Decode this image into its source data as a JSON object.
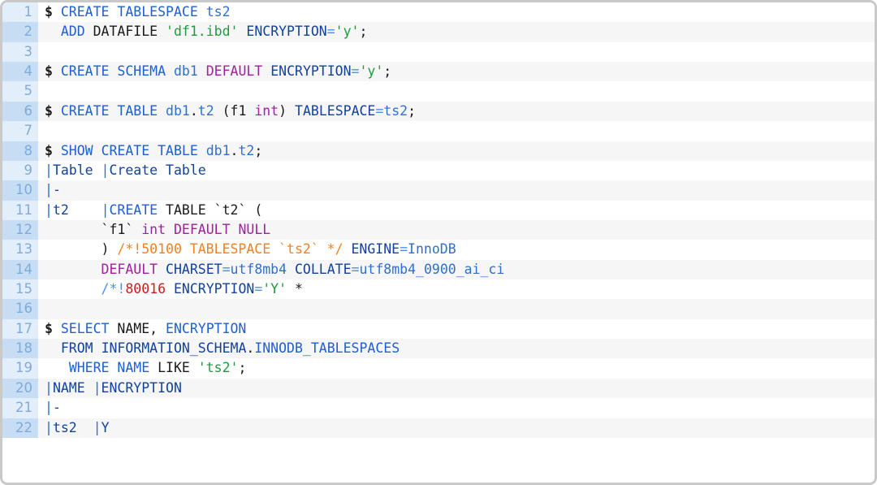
{
  "editor": {
    "name": "sql-code-block",
    "language": "sql",
    "total_lines": 22,
    "colors": {
      "keyword_bright": "#1f5fd0",
      "keyword_navy": "#12429c",
      "identifier": "#2f6fd0",
      "string": "#1f9b3f",
      "purple": "#a0229a",
      "orange": "#f58020",
      "number_red": "#d11b1b",
      "operator": "#4d8fe8",
      "plain": "#1a1a1a",
      "gutter_text": "#7faada",
      "gutter_odd_bg": "#e3eefb",
      "gutter_even_bg": "#c6ddf4",
      "content_odd_bg": "#ffffff",
      "content_even_bg": "#f6f6f6",
      "border": "#c9c9c9"
    }
  },
  "lines": [
    {
      "n": "1",
      "tokens": [
        {
          "t": "$ ",
          "c": "prompt"
        },
        {
          "t": "CREATE",
          "c": "kw"
        },
        {
          "t": " ",
          "c": "plain"
        },
        {
          "t": "TABLESPACE",
          "c": "kw"
        },
        {
          "t": " ",
          "c": "plain"
        },
        {
          "t": "ts2",
          "c": "ident"
        }
      ]
    },
    {
      "n": "2",
      "tokens": [
        {
          "t": "  ",
          "c": "plain"
        },
        {
          "t": "ADD",
          "c": "kw"
        },
        {
          "t": " ",
          "c": "plain"
        },
        {
          "t": "DATAFILE",
          "c": "plain"
        },
        {
          "t": " ",
          "c": "plain"
        },
        {
          "t": "'df1.ibd'",
          "c": "str"
        },
        {
          "t": " ",
          "c": "plain"
        },
        {
          "t": "ENCRYPTION",
          "c": "kw2"
        },
        {
          "t": "=",
          "c": "op"
        },
        {
          "t": "'y'",
          "c": "str"
        },
        {
          "t": ";",
          "c": "plain"
        }
      ]
    },
    {
      "n": "3",
      "tokens": []
    },
    {
      "n": "4",
      "tokens": [
        {
          "t": "$ ",
          "c": "prompt"
        },
        {
          "t": "CREATE",
          "c": "kw"
        },
        {
          "t": " ",
          "c": "plain"
        },
        {
          "t": "SCHEMA",
          "c": "kw"
        },
        {
          "t": " ",
          "c": "plain"
        },
        {
          "t": "db1",
          "c": "ident"
        },
        {
          "t": " ",
          "c": "plain"
        },
        {
          "t": "DEFAULT",
          "c": "purple"
        },
        {
          "t": " ",
          "c": "plain"
        },
        {
          "t": "ENCRYPTION",
          "c": "kw2"
        },
        {
          "t": "=",
          "c": "op"
        },
        {
          "t": "'y'",
          "c": "str"
        },
        {
          "t": ";",
          "c": "plain"
        }
      ]
    },
    {
      "n": "5",
      "tokens": []
    },
    {
      "n": "6",
      "tokens": [
        {
          "t": "$ ",
          "c": "prompt"
        },
        {
          "t": "CREATE",
          "c": "kw"
        },
        {
          "t": " ",
          "c": "plain"
        },
        {
          "t": "TABLE",
          "c": "kw"
        },
        {
          "t": " ",
          "c": "plain"
        },
        {
          "t": "db1",
          "c": "ident"
        },
        {
          "t": ".",
          "c": "plain"
        },
        {
          "t": "t2",
          "c": "ident"
        },
        {
          "t": " (",
          "c": "plain"
        },
        {
          "t": "f1",
          "c": "plain"
        },
        {
          "t": " ",
          "c": "plain"
        },
        {
          "t": "int",
          "c": "purple"
        },
        {
          "t": ") ",
          "c": "plain"
        },
        {
          "t": "TABLESPACE",
          "c": "kw2"
        },
        {
          "t": "=",
          "c": "op"
        },
        {
          "t": "ts2",
          "c": "ident"
        },
        {
          "t": ";",
          "c": "plain"
        }
      ]
    },
    {
      "n": "7",
      "tokens": []
    },
    {
      "n": "8",
      "tokens": [
        {
          "t": "$ ",
          "c": "prompt"
        },
        {
          "t": "SHOW",
          "c": "kw"
        },
        {
          "t": " ",
          "c": "plain"
        },
        {
          "t": "CREATE",
          "c": "kw"
        },
        {
          "t": " ",
          "c": "plain"
        },
        {
          "t": "TABLE",
          "c": "kw"
        },
        {
          "t": " ",
          "c": "plain"
        },
        {
          "t": "db1",
          "c": "ident"
        },
        {
          "t": ".",
          "c": "plain"
        },
        {
          "t": "t2",
          "c": "ident"
        },
        {
          "t": ";",
          "c": "plain"
        }
      ]
    },
    {
      "n": "9",
      "tokens": [
        {
          "t": "|",
          "c": "pipe"
        },
        {
          "t": "Table ",
          "c": "kw2"
        },
        {
          "t": "|",
          "c": "pipe"
        },
        {
          "t": "Create Table",
          "c": "kw2"
        }
      ]
    },
    {
      "n": "10",
      "tokens": [
        {
          "t": "|",
          "c": "pipe"
        },
        {
          "t": "-",
          "c": "kw2"
        }
      ]
    },
    {
      "n": "11",
      "tokens": [
        {
          "t": "|",
          "c": "pipe"
        },
        {
          "t": "t2",
          "c": "kw2"
        },
        {
          "t": "    ",
          "c": "plain"
        },
        {
          "t": "|",
          "c": "pipe"
        },
        {
          "t": "CREATE",
          "c": "kw"
        },
        {
          "t": " ",
          "c": "plain"
        },
        {
          "t": "TABLE",
          "c": "plain"
        },
        {
          "t": " `t2` (",
          "c": "plain"
        }
      ]
    },
    {
      "n": "12",
      "tokens": [
        {
          "t": "       `f1` ",
          "c": "plain"
        },
        {
          "t": "int",
          "c": "purple"
        },
        {
          "t": " ",
          "c": "plain"
        },
        {
          "t": "DEFAULT",
          "c": "purple"
        },
        {
          "t": " ",
          "c": "plain"
        },
        {
          "t": "NULL",
          "c": "purple"
        }
      ]
    },
    {
      "n": "13",
      "tokens": [
        {
          "t": "       ) ",
          "c": "plain"
        },
        {
          "t": "/*!50100 TABLESPACE `ts2` */",
          "c": "orange"
        },
        {
          "t": " ",
          "c": "plain"
        },
        {
          "t": "ENGINE",
          "c": "kw2"
        },
        {
          "t": "=",
          "c": "op"
        },
        {
          "t": "InnoDB",
          "c": "ident"
        }
      ]
    },
    {
      "n": "14",
      "tokens": [
        {
          "t": "       ",
          "c": "plain"
        },
        {
          "t": "DEFAULT",
          "c": "purple"
        },
        {
          "t": " ",
          "c": "plain"
        },
        {
          "t": "CHARSET",
          "c": "kw2"
        },
        {
          "t": "=",
          "c": "op"
        },
        {
          "t": "utf8mb4",
          "c": "ident"
        },
        {
          "t": " ",
          "c": "plain"
        },
        {
          "t": "COLLATE",
          "c": "kw2"
        },
        {
          "t": "=",
          "c": "op"
        },
        {
          "t": "utf8mb4_0900_ai_ci",
          "c": "ident"
        }
      ]
    },
    {
      "n": "15",
      "tokens": [
        {
          "t": "       ",
          "c": "plain"
        },
        {
          "t": "/*!",
          "c": "op"
        },
        {
          "t": "80016",
          "c": "red"
        },
        {
          "t": " ",
          "c": "plain"
        },
        {
          "t": "ENCRYPTION",
          "c": "kw2"
        },
        {
          "t": "=",
          "c": "op"
        },
        {
          "t": "'Y'",
          "c": "str"
        },
        {
          "t": " *",
          "c": "plain"
        }
      ]
    },
    {
      "n": "16",
      "tokens": []
    },
    {
      "n": "17",
      "tokens": [
        {
          "t": "$ ",
          "c": "prompt"
        },
        {
          "t": "SELECT",
          "c": "kw"
        },
        {
          "t": " ",
          "c": "plain"
        },
        {
          "t": "NAME,",
          "c": "plain"
        },
        {
          "t": " ",
          "c": "plain"
        },
        {
          "t": "ENCRYPTION",
          "c": "kw"
        }
      ]
    },
    {
      "n": "18",
      "tokens": [
        {
          "t": "  ",
          "c": "plain"
        },
        {
          "t": "FROM",
          "c": "kw2"
        },
        {
          "t": " ",
          "c": "plain"
        },
        {
          "t": "INFORMATION_SCHEMA",
          "c": "kw2"
        },
        {
          "t": ".",
          "c": "plain"
        },
        {
          "t": "INNODB_TABLESPACES",
          "c": "kw"
        }
      ]
    },
    {
      "n": "19",
      "tokens": [
        {
          "t": "   ",
          "c": "plain"
        },
        {
          "t": "WHERE",
          "c": "kw"
        },
        {
          "t": " ",
          "c": "plain"
        },
        {
          "t": "NAME",
          "c": "kw"
        },
        {
          "t": " ",
          "c": "plain"
        },
        {
          "t": "LIKE",
          "c": "plain"
        },
        {
          "t": " ",
          "c": "plain"
        },
        {
          "t": "'ts2'",
          "c": "str"
        },
        {
          "t": ";",
          "c": "plain"
        }
      ]
    },
    {
      "n": "20",
      "tokens": [
        {
          "t": "|",
          "c": "pipe"
        },
        {
          "t": "NAME ",
          "c": "kw2"
        },
        {
          "t": "|",
          "c": "pipe"
        },
        {
          "t": "ENCRYPTION",
          "c": "kw2"
        }
      ]
    },
    {
      "n": "21",
      "tokens": [
        {
          "t": "|",
          "c": "pipe"
        },
        {
          "t": "-",
          "c": "kw2"
        }
      ]
    },
    {
      "n": "22",
      "tokens": [
        {
          "t": "|",
          "c": "pipe"
        },
        {
          "t": "ts2",
          "c": "kw2"
        },
        {
          "t": "  ",
          "c": "plain"
        },
        {
          "t": "|",
          "c": "pipe"
        },
        {
          "t": "Y",
          "c": "kw2"
        }
      ]
    }
  ],
  "plain_text": [
    "$ CREATE TABLESPACE ts2",
    "  ADD DATAFILE 'df1.ibd' ENCRYPTION='y';",
    "",
    "$ CREATE SCHEMA db1 DEFAULT ENCRYPTION='y';",
    "",
    "$ CREATE TABLE db1.t2 (f1 int) TABLESPACE=ts2;",
    "",
    "$ SHOW CREATE TABLE db1.t2;",
    "|Table |Create Table",
    "|-",
    "|t2    |CREATE TABLE `t2` (",
    "       `f1` int DEFAULT NULL",
    "       ) /*!50100 TABLESPACE `ts2` */ ENGINE=InnoDB",
    "       DEFAULT CHARSET=utf8mb4 COLLATE=utf8mb4_0900_ai_ci",
    "       /*!80016 ENCRYPTION='Y' *",
    "",
    "$ SELECT NAME, ENCRYPTION",
    "  FROM INFORMATION_SCHEMA.INNODB_TABLESPACES",
    "   WHERE NAME LIKE 'ts2';",
    "|NAME |ENCRYPTION",
    "|-",
    "|ts2  |Y"
  ]
}
